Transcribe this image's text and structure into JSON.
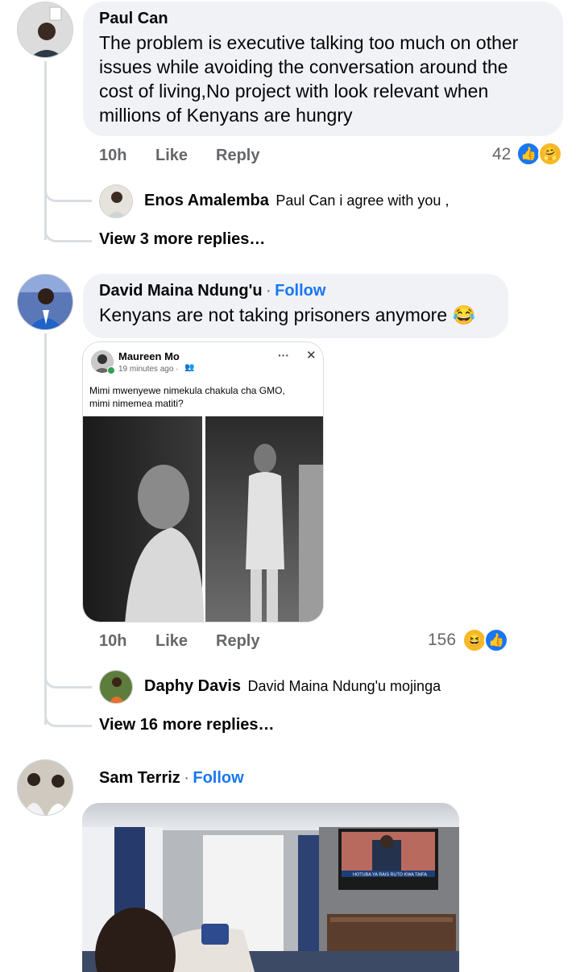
{
  "comments": [
    {
      "author": "Paul Can",
      "text": "The problem is executive talking too much on other issues while avoiding the conversation around the cost of living,No project with look relevant when millions of Kenyans are hungry",
      "time": "10h",
      "like_label": "Like",
      "reply_label": "Reply",
      "reaction_count": "42",
      "reactions": [
        "like-icon",
        "care-icon"
      ],
      "top_reply": {
        "author": "Enos Amalemba",
        "text": "Paul Can i agree with you ,"
      },
      "more_replies": "View 3 more replies…"
    },
    {
      "author": "David Maina Ndung'u",
      "follow_label": "Follow",
      "separator": "·",
      "text": "Kenyans are not taking prisoners anymore 😂",
      "embedded_post": {
        "author": "Maureen Mo",
        "time": "19 minutes ago ·",
        "text": "Mimi mwenyewe nimekula chakula cha GMO, mimi nimemea matiti?",
        "menu": "···",
        "close": "✕"
      },
      "time": "10h",
      "like_label": "Like",
      "reply_label": "Reply",
      "reaction_count": "156",
      "reactions": [
        "haha-icon",
        "like-icon"
      ],
      "top_reply": {
        "author": "Daphy Davis",
        "text": "David Maina Ndung'u mojinga"
      },
      "more_replies": "View 16 more replies…"
    },
    {
      "author": "Sam Terriz",
      "follow_label": "Follow",
      "separator": "·",
      "tv_caption": "HOTUBA YA RAIS RUTO KWA TAIFA"
    }
  ],
  "colors": {
    "accent": "#1877f2",
    "bubble": "#f0f2f5",
    "meta": "#65676b"
  }
}
